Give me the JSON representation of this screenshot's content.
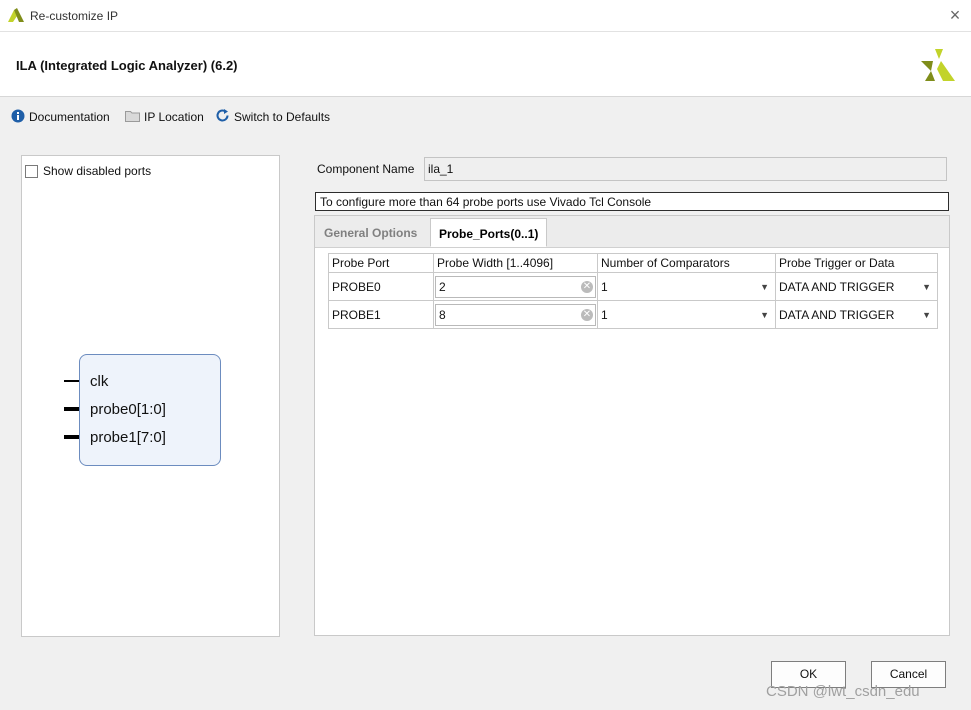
{
  "window": {
    "title": "Re-customize IP",
    "close_glyph": "×"
  },
  "header": {
    "ip_title": "ILA (Integrated Logic Analyzer) (6.2)",
    "logo": "xilinx-logo"
  },
  "toolbar": {
    "documentation": "Documentation",
    "ip_location": "IP Location",
    "switch_defaults": "Switch to Defaults"
  },
  "left": {
    "show_disabled_ports": "Show disabled ports",
    "show_disabled_checked": false,
    "pins": [
      "clk",
      "probe0[1:0]",
      "probe1[7:0]"
    ]
  },
  "right": {
    "component_name_label": "Component Name",
    "component_name_value": "ila_1",
    "info_text": "To configure more than 64 probe ports use Vivado Tcl Console",
    "tabs": [
      {
        "label": "General Options",
        "active": false
      },
      {
        "label": "Probe_Ports(0..1)",
        "active": true
      }
    ],
    "table": {
      "headers": [
        "Probe Port",
        "Probe Width [1..4096]",
        "Number of Comparators",
        "Probe Trigger or Data"
      ],
      "rows": [
        {
          "port": "PROBE0",
          "width": "2",
          "comparators": "1",
          "trigger": "DATA AND TRIGGER"
        },
        {
          "port": "PROBE1",
          "width": "8",
          "comparators": "1",
          "trigger": "DATA AND TRIGGER"
        }
      ]
    }
  },
  "buttons": {
    "ok": "OK",
    "cancel": "Cancel"
  },
  "watermark": "CSDN @lwt_csdn_edu",
  "colors": {
    "info_icon": "#1f5fa8",
    "refresh_icon": "#1f5fa8",
    "symbol_fill": "#eef3fb",
    "symbol_border": "#6c8cbf",
    "logo_light": "#c2d32a",
    "logo_dark": "#7f8d1a"
  }
}
